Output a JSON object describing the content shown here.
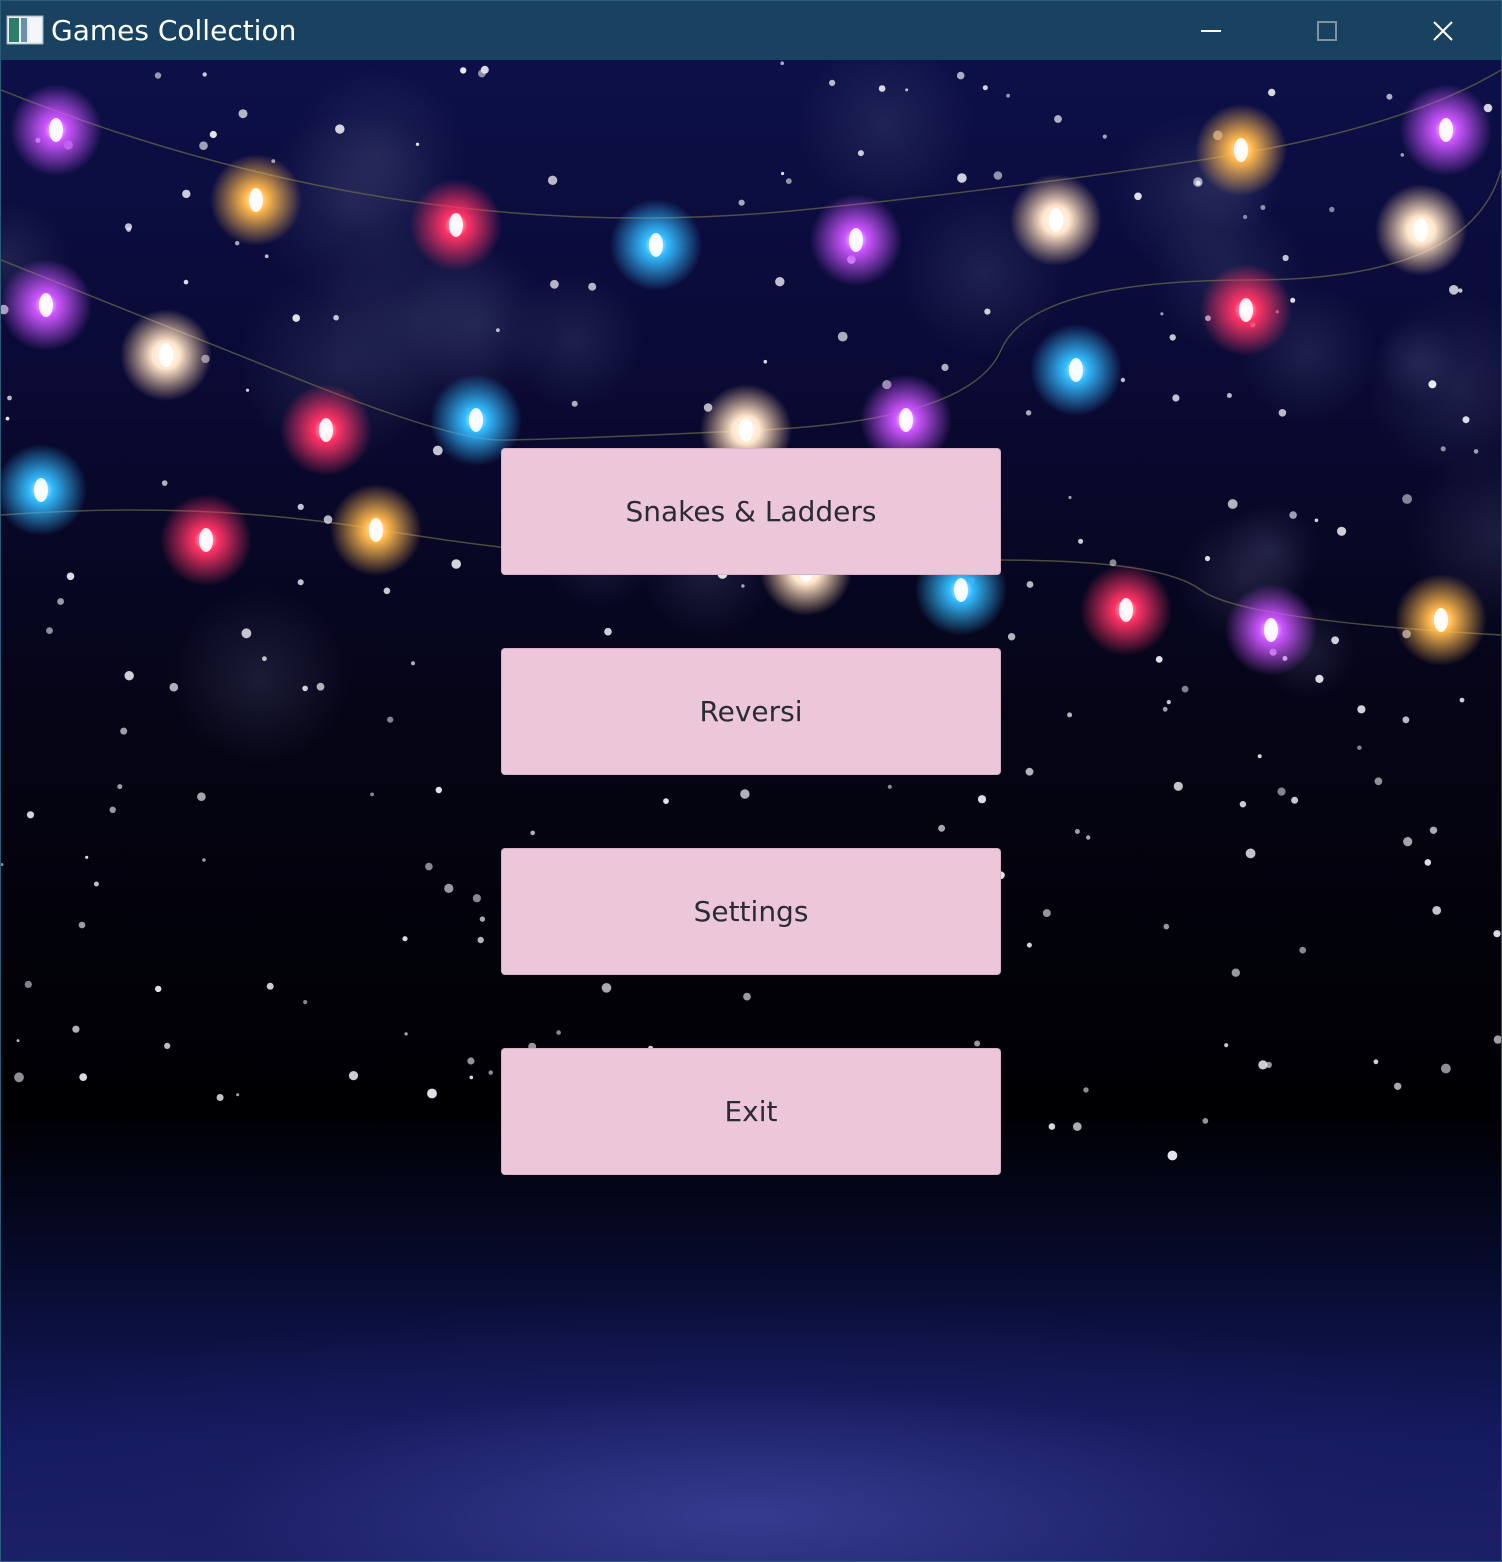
{
  "window": {
    "title": "Games Collection",
    "icon": "app-window-icon",
    "controls": [
      "minimize-icon",
      "maximize-icon",
      "close-icon"
    ]
  },
  "background": {
    "theme": "string lights night sky with snowflakes",
    "light_colors": [
      "#ff3366",
      "#ffb84d",
      "#cc55ff",
      "#33bbff",
      "#ffe6cc"
    ]
  },
  "menu": {
    "buttons": [
      {
        "label": "Snakes & Ladders"
      },
      {
        "label": "Reversi"
      },
      {
        "label": "Settings"
      },
      {
        "label": "Exit"
      }
    ]
  },
  "colors": {
    "titlebar": "#18425f",
    "button_bg": "#ecc6d9",
    "button_text": "#2b2b33"
  }
}
